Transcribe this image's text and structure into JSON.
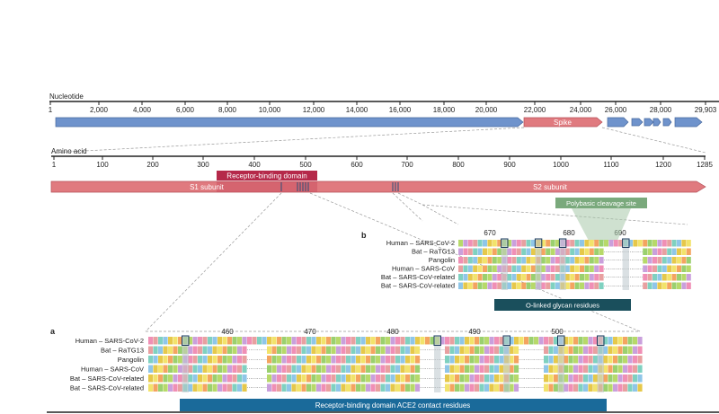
{
  "nucleotide": {
    "label": "Nucleotide",
    "ticks": [
      "1",
      "2,000",
      "4,000",
      "6,000",
      "8,000",
      "10,000",
      "12,000",
      "14,000",
      "16,000",
      "18,000",
      "20,000",
      "22,000",
      "24,000",
      "26,000",
      "28,000",
      "29,903"
    ],
    "spike_label": "Spike"
  },
  "amino_acid": {
    "label": "Amino acid",
    "ticks": [
      "1",
      "100",
      "200",
      "300",
      "400",
      "500",
      "600",
      "700",
      "800",
      "900",
      "1000",
      "1100",
      "1200",
      "1285"
    ],
    "rbd_label": "Receptor-binding domain",
    "s1_label": "S1 subunit",
    "s2_label": "S2 subunit"
  },
  "panel_b": {
    "letter": "b",
    "positions": [
      "670",
      "680",
      "690"
    ],
    "cleavage_label": "Polybasic cleavage site",
    "glycan_label": "O-linked glycan residues",
    "species": [
      "Human – SARS-CoV-2",
      "Bat – RaTG13",
      "Pangolin",
      "Human – SARS-CoV",
      "Bat – SARS-CoV-related",
      "Bat – SARS-CoV-related"
    ]
  },
  "panel_a": {
    "letter": "a",
    "positions": [
      "460",
      "470",
      "480",
      "490",
      "500"
    ],
    "contact_label": "Receptor-binding domain ACE2 contact residues",
    "species": [
      "Human – SARS-CoV-2",
      "Bat – RaTG13",
      "Pangolin",
      "Human – SARS-CoV",
      "Bat – SARS-CoV-related",
      "Bat – SARS-CoV-related"
    ]
  },
  "colors": {
    "genome_blue": "#6f93cc",
    "spike_red": "#e07a7f",
    "rbd_crimson": "#b5294a",
    "cleavage_green": "#7aa97c",
    "contact_blue": "#1a6a9a",
    "glycan_teal": "#1a4f5c"
  }
}
